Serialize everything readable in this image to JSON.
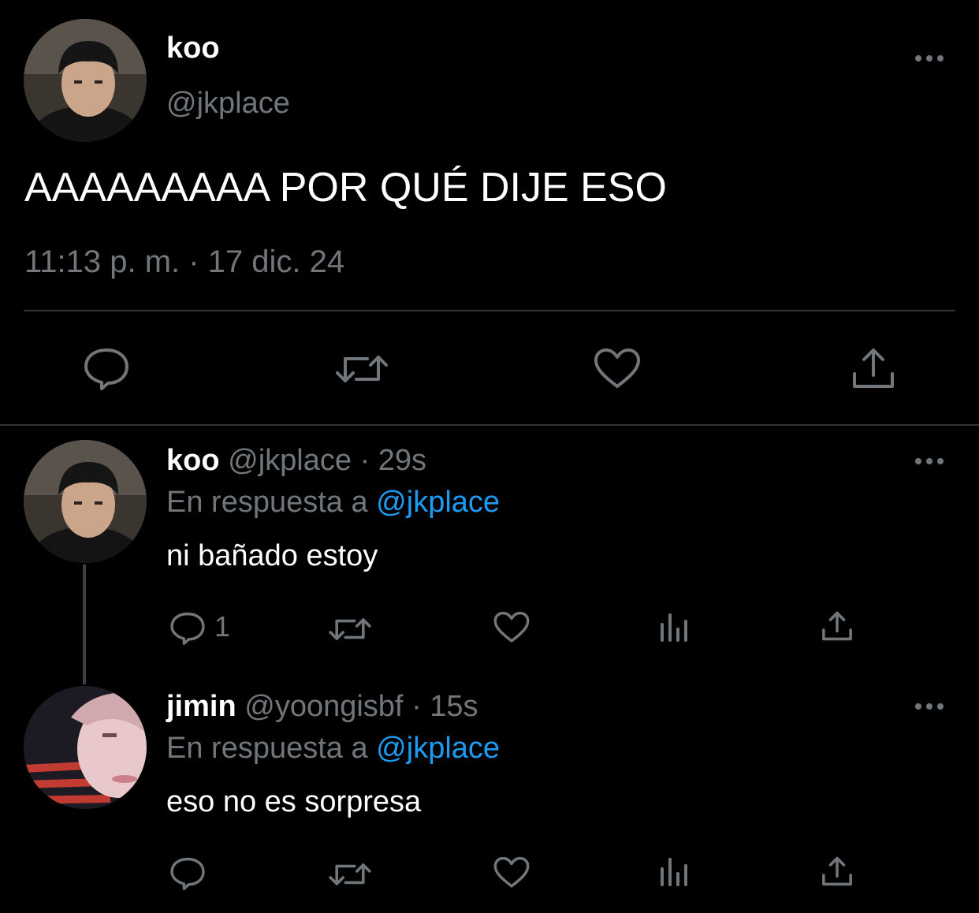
{
  "main_tweet": {
    "display_name": "koo",
    "handle": "@jkplace",
    "text": "AAAAAAAAA POR QUÉ DIJE ESO",
    "timestamp": "11:13 p. m. · 17 dic. 24",
    "actions": [
      "reply-icon",
      "retweet-icon",
      "like-icon",
      "share-icon"
    ]
  },
  "replies": [
    {
      "display_name": "koo",
      "handle": "@jkplace",
      "time": "· 29s",
      "reply_prefix": "En respuesta a",
      "reply_to": "@jkplace",
      "text": "ni bañado estoy",
      "reply_count": "1"
    },
    {
      "display_name": "jimin",
      "handle": "@yoongisbf",
      "time": "· 15s",
      "reply_prefix": "En respuesta a",
      "reply_to": "@jkplace",
      "text": "eso no es sorpresa",
      "reply_count": ""
    }
  ],
  "colors": {
    "background": "#000000",
    "muted": "#71767b",
    "link": "#1d9bf0",
    "divider": "#2f3336"
  }
}
